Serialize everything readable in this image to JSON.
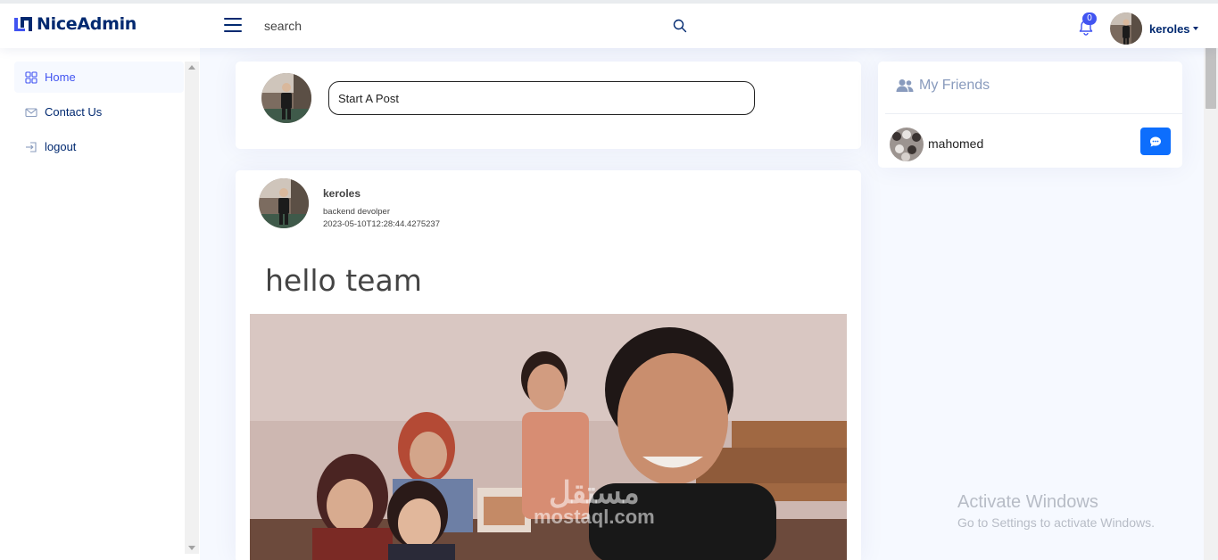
{
  "header": {
    "logo_text": "NiceAdmin",
    "search_placeholder": "search",
    "notification_count": "0",
    "profile_name": "keroles"
  },
  "sidebar": {
    "items": [
      {
        "label": "Home",
        "icon": "grid-icon",
        "active": true
      },
      {
        "label": "Contact Us",
        "icon": "envelope-icon",
        "active": false
      },
      {
        "label": "logout",
        "icon": "box-arrow-in-right-icon",
        "active": false
      }
    ]
  },
  "composer": {
    "placeholder": "Start A Post"
  },
  "post": {
    "author": "keroles",
    "role": "backend devolper",
    "timestamp": "2023-05-10T12:28:44.4275237",
    "text": "hello team"
  },
  "friends": {
    "title": "My Friends",
    "items": [
      {
        "name": "mahomed"
      }
    ]
  },
  "watermarks": {
    "activate_title": "Activate Windows",
    "activate_sub": "Go to Settings to activate Windows.",
    "mostaql_ar": "مستقل",
    "mostaql_en": "mostaql.com"
  },
  "colors": {
    "brand": "#012970",
    "accent": "#4154f1",
    "page_bg": "#f6f9ff",
    "chat_button": "#0d6efd"
  }
}
